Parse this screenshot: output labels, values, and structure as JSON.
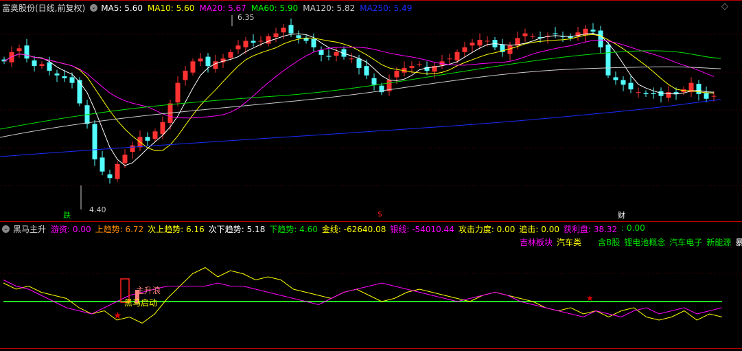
{
  "header": {
    "title": "富奥股份(日线,前复权)",
    "ma": [
      {
        "label": "MA5: 5.60",
        "color": "#ffffff"
      },
      {
        "label": "MA10: 5.60",
        "color": "#ffff00"
      },
      {
        "label": "MA20: 5.67",
        "color": "#ff00ff"
      },
      {
        "label": "MA60: 5.90",
        "color": "#00ff00"
      },
      {
        "label": "MA120: 5.82",
        "color": "#cccccc"
      },
      {
        "label": "MA250: 5.49",
        "color": "#1a2cff"
      }
    ]
  },
  "main_chart": {
    "high_label": "6.35",
    "low_label": "4.40",
    "markers": [
      {
        "text": "跌",
        "color": "#00e000"
      },
      {
        "text": "$",
        "color": "#ff2020"
      },
      {
        "text": "财",
        "color": "#ffffff"
      }
    ]
  },
  "indicator": {
    "name": "黑马主升",
    "values": [
      {
        "label": "游资: 0.00",
        "color": "#ff00ff"
      },
      {
        "label": "上趋势: 6.72",
        "color": "#ff8c00"
      },
      {
        "label": "次上趋势: 6.16",
        "color": "#ffff00"
      },
      {
        "label": "次下趋势: 5.18",
        "color": "#ffffff"
      },
      {
        "label": "下趋势: 4.60",
        "color": "#00e000"
      },
      {
        "label": "金线: -62640.08",
        "color": "#ffff00"
      },
      {
        "label": "银线: -54010.44",
        "color": "#ff00ff"
      },
      {
        "label": "攻击力度: 0.00",
        "color": "#ffff00"
      },
      {
        "label": "追击: 0.00",
        "color": "#ffff00"
      },
      {
        "label": "获利盘: 38.32",
        "color": "#ff00ff"
      },
      {
        "label": ": 0.00",
        "color": "#00e000"
      }
    ],
    "tags": [
      {
        "text": "吉林板块",
        "color": "#ff00ff"
      },
      {
        "text": "汽车类",
        "color": "#ffff00"
      },
      {
        "text": "含B股",
        "color": "#00e000"
      },
      {
        "text": "锂电池概念",
        "color": "#00e000"
      },
      {
        "text": "汽车电子",
        "color": "#00e000"
      },
      {
        "text": "新能源",
        "color": "#00e000"
      },
      {
        "text": "暴力",
        "color": "#ffffff"
      }
    ],
    "annotations": {
      "wave": "主升浪",
      "start": "黑马启动"
    }
  },
  "chart_data": {
    "type": "candlestick",
    "price_range": [
      4.4,
      6.35
    ],
    "closes": [
      5.95,
      6.05,
      6.09,
      5.98,
      5.9,
      5.92,
      5.85,
      5.8,
      5.77,
      5.72,
      5.5,
      5.28,
      4.9,
      4.77,
      4.7,
      4.85,
      4.95,
      5.05,
      5.14,
      5.1,
      5.2,
      5.3,
      5.5,
      5.72,
      5.85,
      5.95,
      5.98,
      5.9,
      5.95,
      5.98,
      6.05,
      6.12,
      6.17,
      6.15,
      6.17,
      6.22,
      6.25,
      6.31,
      6.25,
      6.2,
      6.17,
      6.1,
      6.02,
      6.0,
      6.05,
      6.0,
      5.98,
      5.88,
      5.8,
      5.7,
      5.62,
      5.75,
      5.85,
      5.88,
      5.9,
      5.92,
      5.85,
      5.9,
      5.95,
      5.98,
      6.05,
      6.1,
      6.15,
      6.18,
      6.17,
      6.1,
      6.05,
      6.12,
      6.2,
      6.25,
      6.22,
      6.2,
      6.22,
      6.24,
      6.22,
      6.2,
      6.26,
      6.3,
      6.27,
      6.1,
      5.8,
      5.75,
      5.7,
      5.65,
      5.62,
      5.6,
      5.6,
      5.58,
      5.62,
      5.6,
      5.65,
      5.72,
      5.6,
      5.55,
      5.58
    ],
    "osc_yellow": [
      0.6,
      0.4,
      0.5,
      0.3,
      0.2,
      0.1,
      -0.2,
      -0.4,
      -0.3,
      -0.6,
      -0.5,
      -0.7,
      -0.4,
      0.1,
      0.5,
      0.9,
      1.1,
      0.8,
      1.0,
      0.9,
      0.7,
      0.8,
      0.7,
      0.4,
      0.3,
      0.2,
      0.1,
      0.3,
      0.4,
      0.2,
      0.0,
      0.1,
      0.3,
      0.4,
      0.3,
      0.2,
      0.1,
      0.0,
      0.2,
      0.3,
      0.2,
      0.1,
      0.0,
      -0.2,
      -0.3,
      -0.2,
      -0.4,
      -0.3,
      -0.5,
      -0.3,
      -0.2,
      -0.5,
      -0.6,
      -0.5,
      -0.3,
      -0.6,
      -0.4,
      -0.5
    ],
    "osc_magenta": [
      0.7,
      0.5,
      0.4,
      0.2,
      0.0,
      -0.2,
      -0.3,
      -0.4,
      -0.2,
      0.0,
      0.2,
      0.3,
      0.4,
      0.5,
      0.5,
      0.5,
      0.5,
      0.6,
      0.5,
      0.5,
      0.4,
      0.3,
      0.2,
      0.1,
      0.0,
      -0.1,
      0.1,
      0.3,
      0.4,
      0.5,
      0.6,
      0.5,
      0.4,
      0.3,
      0.2,
      0.1,
      0.0,
      0.1,
      0.2,
      0.3,
      0.2,
      0.0,
      -0.1,
      -0.2,
      -0.3,
      -0.4,
      -0.5,
      -0.3,
      -0.4,
      -0.5,
      -0.3,
      -0.2,
      -0.4,
      -0.3,
      -0.2,
      -0.4,
      -0.3,
      -0.2
    ]
  }
}
